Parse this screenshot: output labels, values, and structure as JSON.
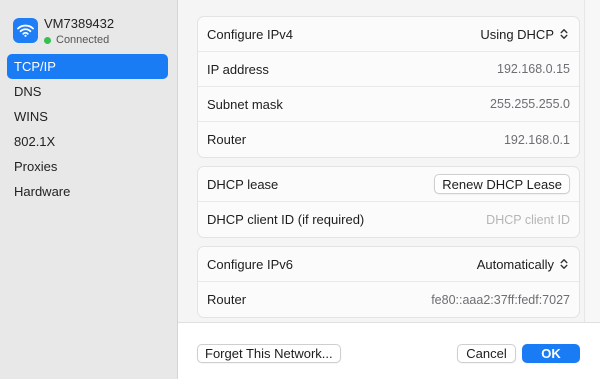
{
  "sidebar": {
    "network_name": "VM7389432",
    "network_status": "Connected",
    "status_color": "#32c24d",
    "items": [
      {
        "label": "TCP/IP",
        "selected": true
      },
      {
        "label": "DNS"
      },
      {
        "label": "WINS"
      },
      {
        "label": "802.1X"
      },
      {
        "label": "Proxies"
      },
      {
        "label": "Hardware"
      }
    ]
  },
  "ipv4": {
    "configure_label": "Configure IPv4",
    "configure_value": "Using DHCP",
    "ip_label": "IP address",
    "ip_value": "192.168.0.15",
    "subnet_label": "Subnet mask",
    "subnet_value": "255.255.255.0",
    "router_label": "Router",
    "router_value": "192.168.0.1"
  },
  "dhcp": {
    "lease_label": "DHCP lease",
    "renew_button": "Renew DHCP Lease",
    "client_id_label": "DHCP client ID (if required)",
    "client_id_placeholder": "DHCP client ID"
  },
  "ipv6": {
    "configure_label": "Configure IPv6",
    "configure_value": "Automatically",
    "router_label": "Router",
    "router_value": "fe80::aaa2:37ff:fedf:7027"
  },
  "footer": {
    "forget_button": "Forget This Network...",
    "cancel_button": "Cancel",
    "ok_button": "OK"
  },
  "colors": {
    "accent": "#1a7cf5"
  }
}
